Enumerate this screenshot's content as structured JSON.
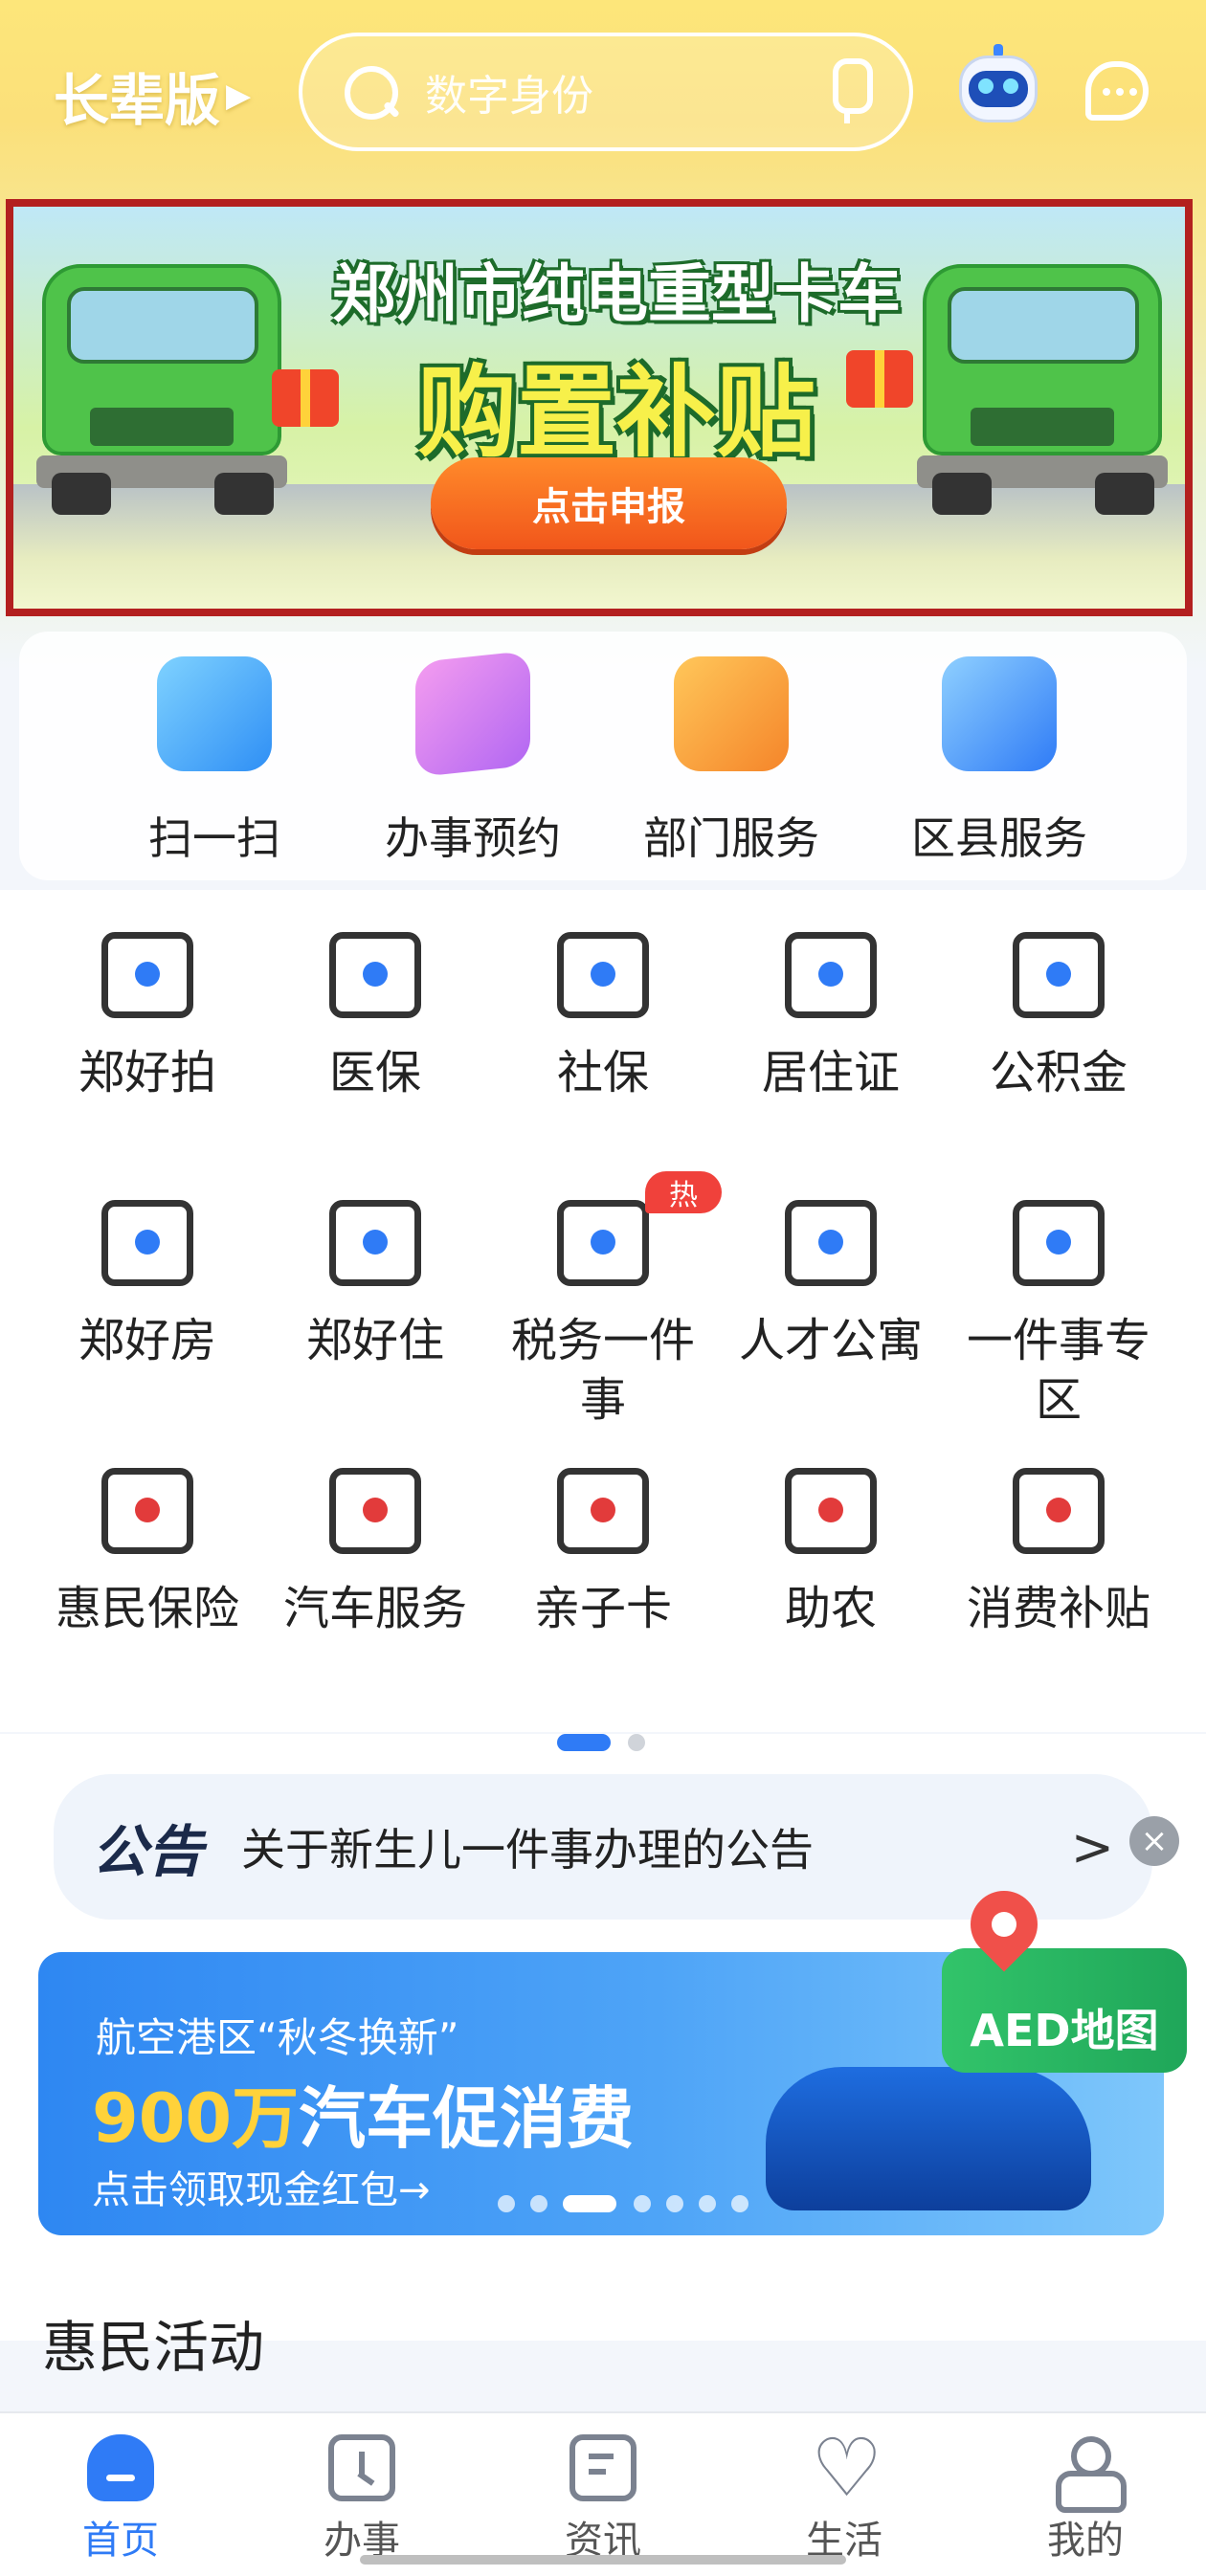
{
  "header": {
    "elder_mode": "长辈版",
    "search_placeholder": "数字身份"
  },
  "banner": {
    "title": "郑州市纯电重型卡车",
    "subtitle": "购置补贴",
    "button": "点击申报"
  },
  "quick_services": [
    {
      "label": "扫一扫",
      "icon": "scan-icon",
      "color": "#3aa0f5"
    },
    {
      "label": "办事预约",
      "icon": "appointment-card-icon",
      "color": "#c772f0"
    },
    {
      "label": "部门服务",
      "icon": "department-star-icon",
      "color": "#f59a2a"
    },
    {
      "label": "区县服务",
      "icon": "district-building-icon",
      "color": "#3a8cf5"
    }
  ],
  "services_row1": [
    {
      "label": "郑好拍",
      "icon": "camera-icon"
    },
    {
      "label": "医保",
      "icon": "medical-kit-icon"
    },
    {
      "label": "社保",
      "icon": "social-security-card-icon"
    },
    {
      "label": "居住证",
      "icon": "residence-permit-icon"
    },
    {
      "label": "公积金",
      "icon": "housing-fund-icon"
    }
  ],
  "services_row2": [
    {
      "label": "郑好房",
      "icon": "house-hands-icon"
    },
    {
      "label": "郑好住",
      "icon": "house-badge-icon"
    },
    {
      "label": "税务一件事",
      "icon": "tax-hand-icon",
      "badge": "热"
    },
    {
      "label": "人才公寓",
      "icon": "apartment-icon"
    },
    {
      "label": "一件事专区",
      "icon": "overlap-squares-icon"
    }
  ],
  "services_row3": [
    {
      "label": "惠民保险",
      "icon": "insurance-hands-icon"
    },
    {
      "label": "汽车服务",
      "icon": "car-service-icon"
    },
    {
      "label": "亲子卡",
      "icon": "parent-child-icon"
    },
    {
      "label": "助农",
      "icon": "farm-basket-icon"
    },
    {
      "label": "消费补贴",
      "icon": "subsidy-bag-icon"
    }
  ],
  "notice": {
    "tag": "公告",
    "text": "关于新生儿一件事办理的公告"
  },
  "promo": {
    "line1": "航空港区“秋冬换新”",
    "line2_highlight": "900万",
    "line2_rest": "汽车促消费",
    "line3": "点击领取现金红包→"
  },
  "aed": {
    "label": "AED地图"
  },
  "section": {
    "title": "惠民活动"
  },
  "tabbar": [
    {
      "label": "首页",
      "active": true
    },
    {
      "label": "办事",
      "active": false
    },
    {
      "label": "资讯",
      "active": false
    },
    {
      "label": "生活",
      "active": false
    },
    {
      "label": "我的",
      "active": false
    }
  ],
  "colors": {
    "accent": "#2f7bf6",
    "banner_border": "#b3201f",
    "hot_badge": "#f0413b"
  }
}
